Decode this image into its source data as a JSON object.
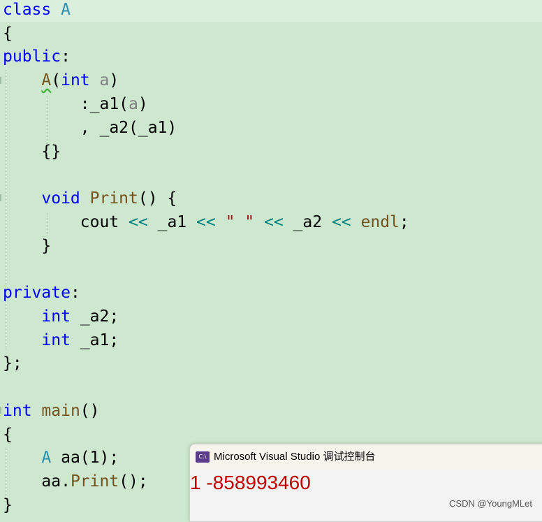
{
  "code": {
    "l1": {
      "kw": "class",
      "name": "A"
    },
    "l2": "{",
    "l3": {
      "kw": "public",
      "colon": ":"
    },
    "l4": {
      "fn": "A",
      "open": "(",
      "type": "int",
      "param": "a",
      "close": ")"
    },
    "l5": {
      "pre": ":_a1(",
      "param": "a",
      "post": ")"
    },
    "l6": ", _a2(_a1)",
    "l7": "{}",
    "l9": {
      "kw": "void",
      "fn": "Print",
      "rest": "() {"
    },
    "l10": {
      "cout": "cout",
      "op1": "<<",
      "v1": "_a1",
      "op2": "<<",
      "str": "\" \"",
      "op3": "<<",
      "v2": "_a2",
      "op4": "<<",
      "endl": "endl",
      "semi": ";"
    },
    "l11": "}",
    "l13": {
      "kw": "private",
      "colon": ":"
    },
    "l14": {
      "kw": "int",
      "rest": "_a2;"
    },
    "l15": {
      "kw": "int",
      "rest": "_a1;"
    },
    "l16": "};",
    "l18": {
      "kw": "int",
      "fn": "main",
      "rest": "()"
    },
    "l19": "{",
    "l20": {
      "cls": "A",
      "rest": "aa(1);"
    },
    "l21": {
      "obj": "aa",
      "dot": ".",
      "fn": "Print",
      "rest": "();"
    },
    "l22": "}"
  },
  "console": {
    "icon": "C:\\",
    "title": "Microsoft Visual Studio 调试控制台",
    "output": "1 -858993460"
  },
  "watermark": "CSDN @YoungMLet"
}
